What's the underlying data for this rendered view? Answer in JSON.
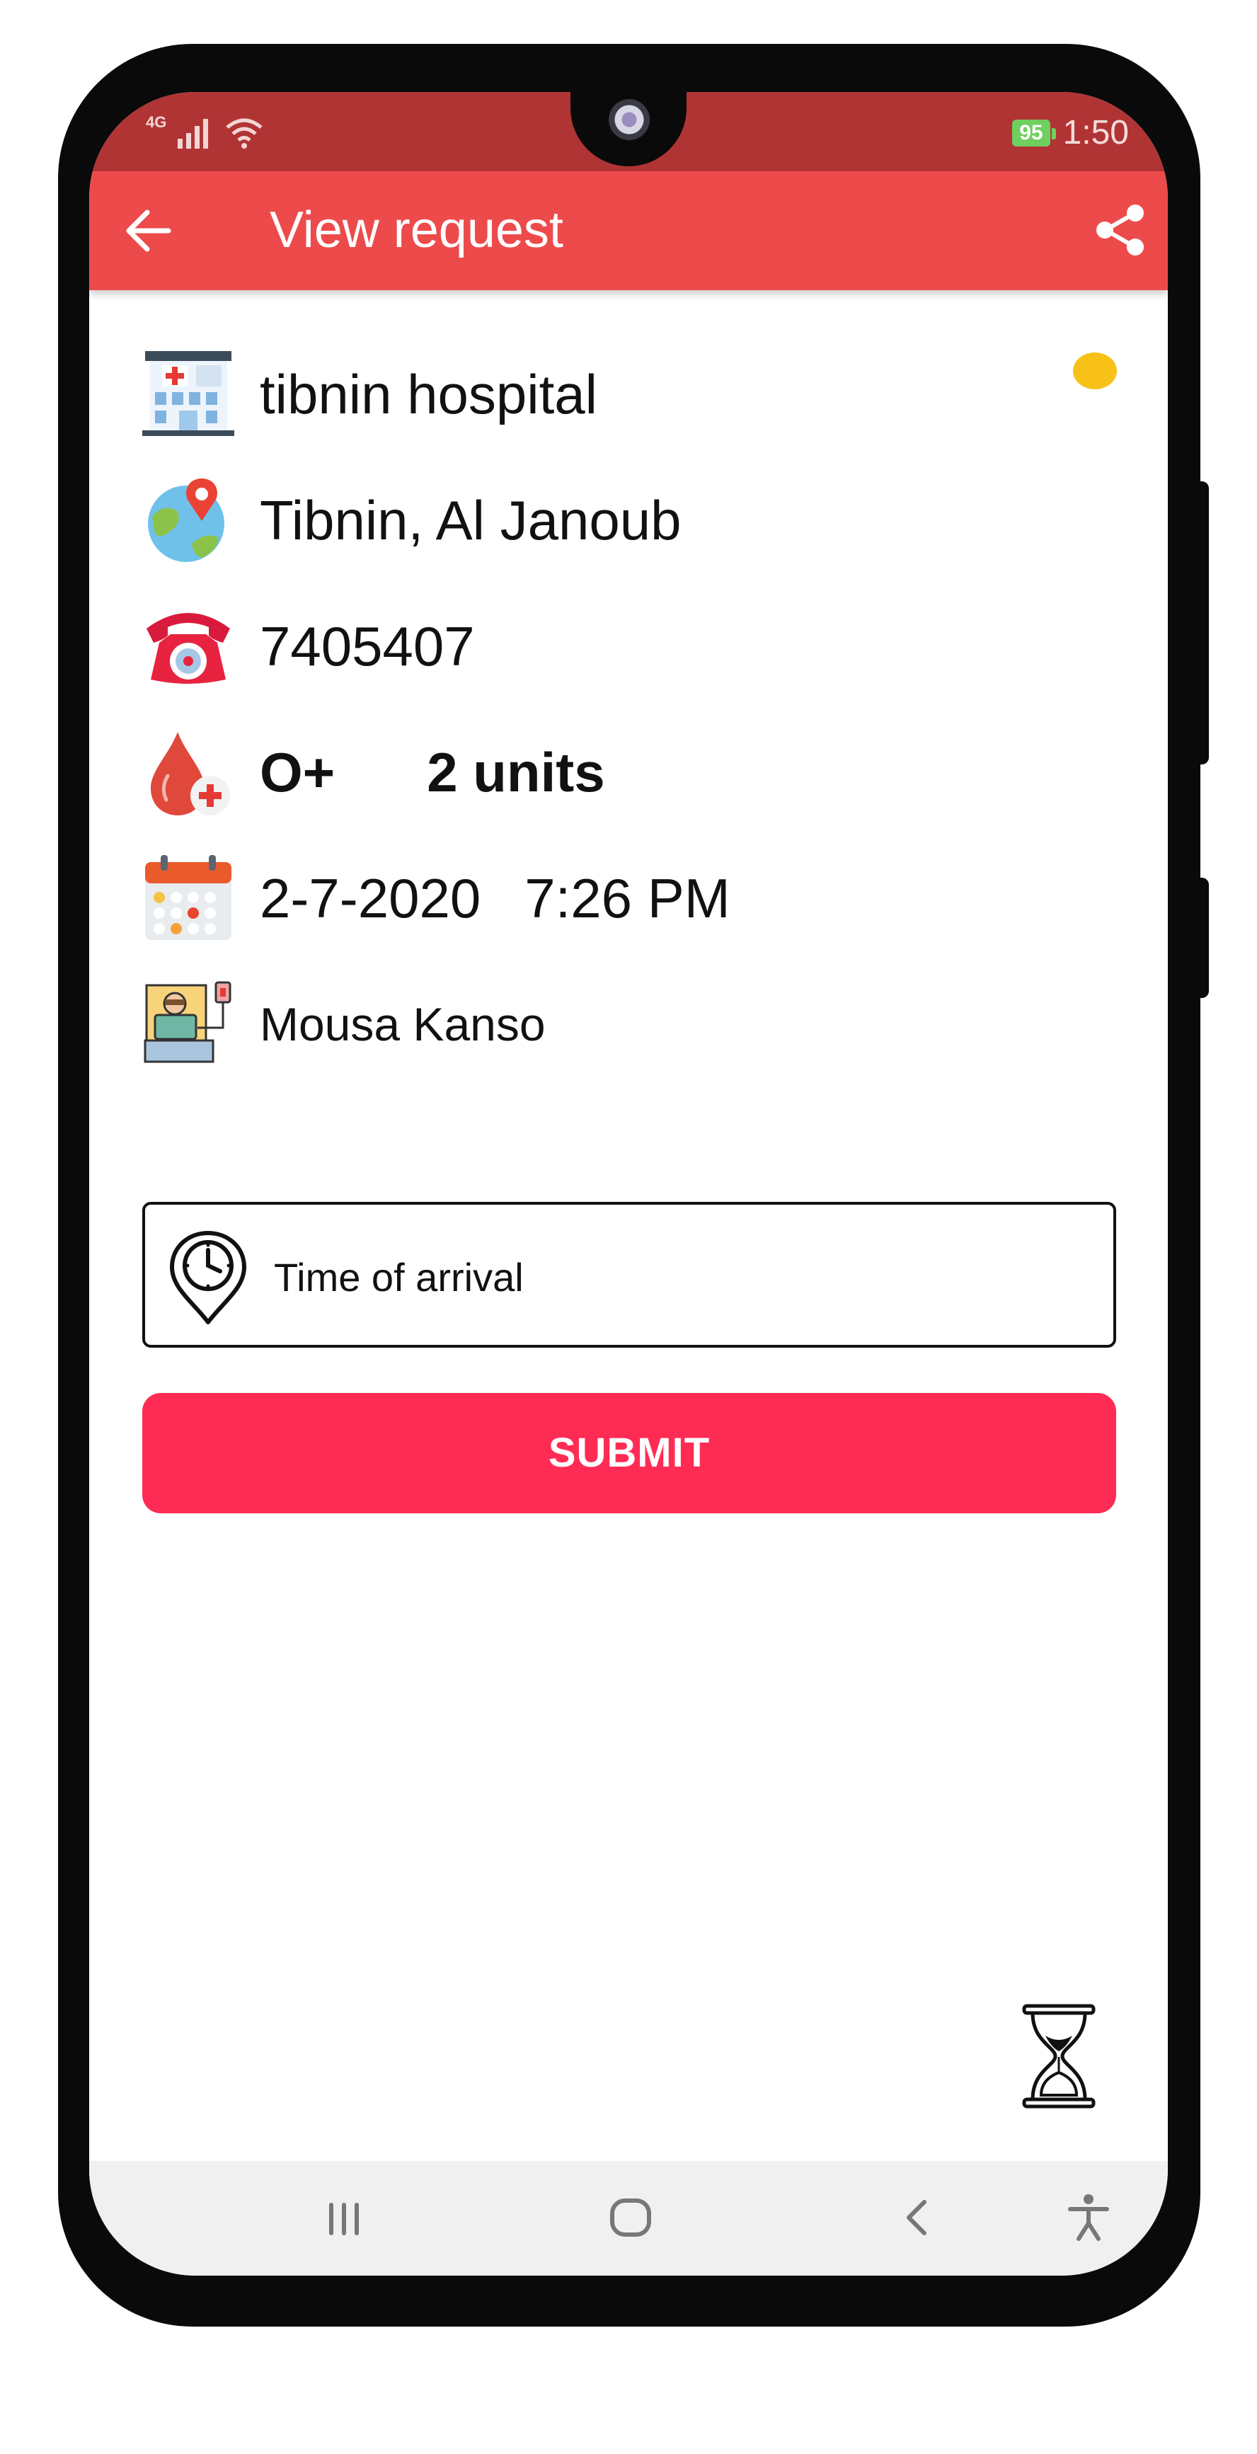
{
  "status_bar": {
    "network_label": "4G",
    "battery_level": "95",
    "time": "1:50"
  },
  "app_bar": {
    "title": "View request"
  },
  "request": {
    "hospital": "tibnin hospital",
    "location": "Tibnin, Al Janoub",
    "phone": "7405407",
    "blood_type": "O+",
    "units": "2 units",
    "date": "2-7-2020",
    "time": "7:26 PM",
    "patient": "Mousa Kanso",
    "status_color": "#f7c118"
  },
  "arrival": {
    "placeholder": "Time of arrival"
  },
  "submit_label": "SUBMIT",
  "colors": {
    "status_bar": "#b13434",
    "app_bar": "#ed4b4b",
    "submit": "#fe2c55"
  }
}
